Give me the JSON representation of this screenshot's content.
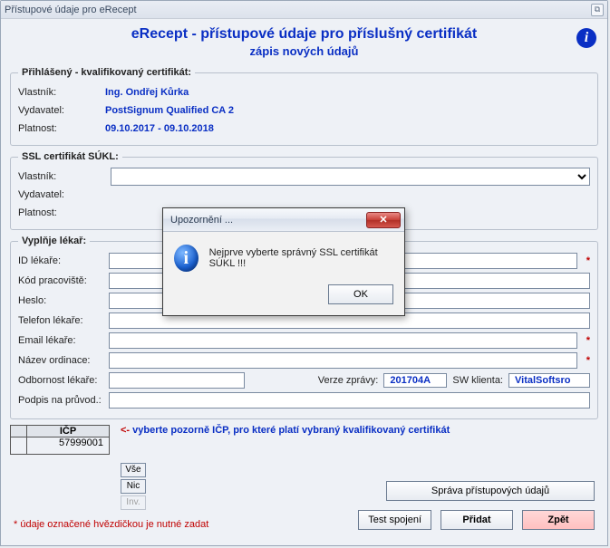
{
  "window": {
    "title": "Přístupové údaje pro eRecept"
  },
  "header": {
    "title": "eRecept - přístupové údaje pro příslušný certifikát",
    "subtitle": "zápis nových údajů",
    "info_icon": "i"
  },
  "cert": {
    "legend": "Přihlášený - kvalifikovaný  certifikát:",
    "owner_label": "Vlastník:",
    "owner_value": "Ing. Ondřej Kůrka",
    "issuer_label": "Vydavatel:",
    "issuer_value": "PostSignum Qualified CA 2",
    "validity_label": "Platnost:",
    "validity_value": "09.10.2017  -  09.10.2018"
  },
  "ssl": {
    "legend": "SSL certifikát SÚKL:",
    "owner_label": "Vlastník:",
    "owner_value": "",
    "issuer_label": "Vydavatel:",
    "validity_label": "Platnost:"
  },
  "lekar": {
    "legend": "Vyplňje lékař:",
    "id_label": "ID lékaře:",
    "kod_label": "Kód pracoviště:",
    "heslo_label": "Heslo:",
    "tel_label": "Telefon lékaře:",
    "email_label": "Email lékaře:",
    "nazev_label": "Název ordinace:",
    "odbornost_label": "Odbornost lékaře:",
    "podpis_label": "Podpis na průvod.:",
    "verze_label": "Verze zprávy:",
    "verze_value": "201704A",
    "sw_label": "SW klienta:",
    "sw_value": "VitalSoftsro"
  },
  "icp": {
    "header": "IČP",
    "rows": [
      "57999001"
    ],
    "hint_arrow": "<-",
    "hint_text": "vyberte pozorně  IČP,  pro které platí vybraný kvalifikovaný certifikát"
  },
  "buttons": {
    "vse": "Vše",
    "nic": "Nic",
    "inv": "Inv.",
    "sprava": "Správa přístupových údajů",
    "test": "Test spojení",
    "pridat": "Přidat",
    "zpet": "Zpět"
  },
  "footnote": "* údaje označené hvězdičkou  je nutné zadat",
  "modal": {
    "title": "Upozornění ...",
    "message": "Nejprve vyberte správný SSL certifikát SÚKL !!!",
    "ok": "OK",
    "close_glyph": "✕",
    "icon_glyph": "i"
  }
}
